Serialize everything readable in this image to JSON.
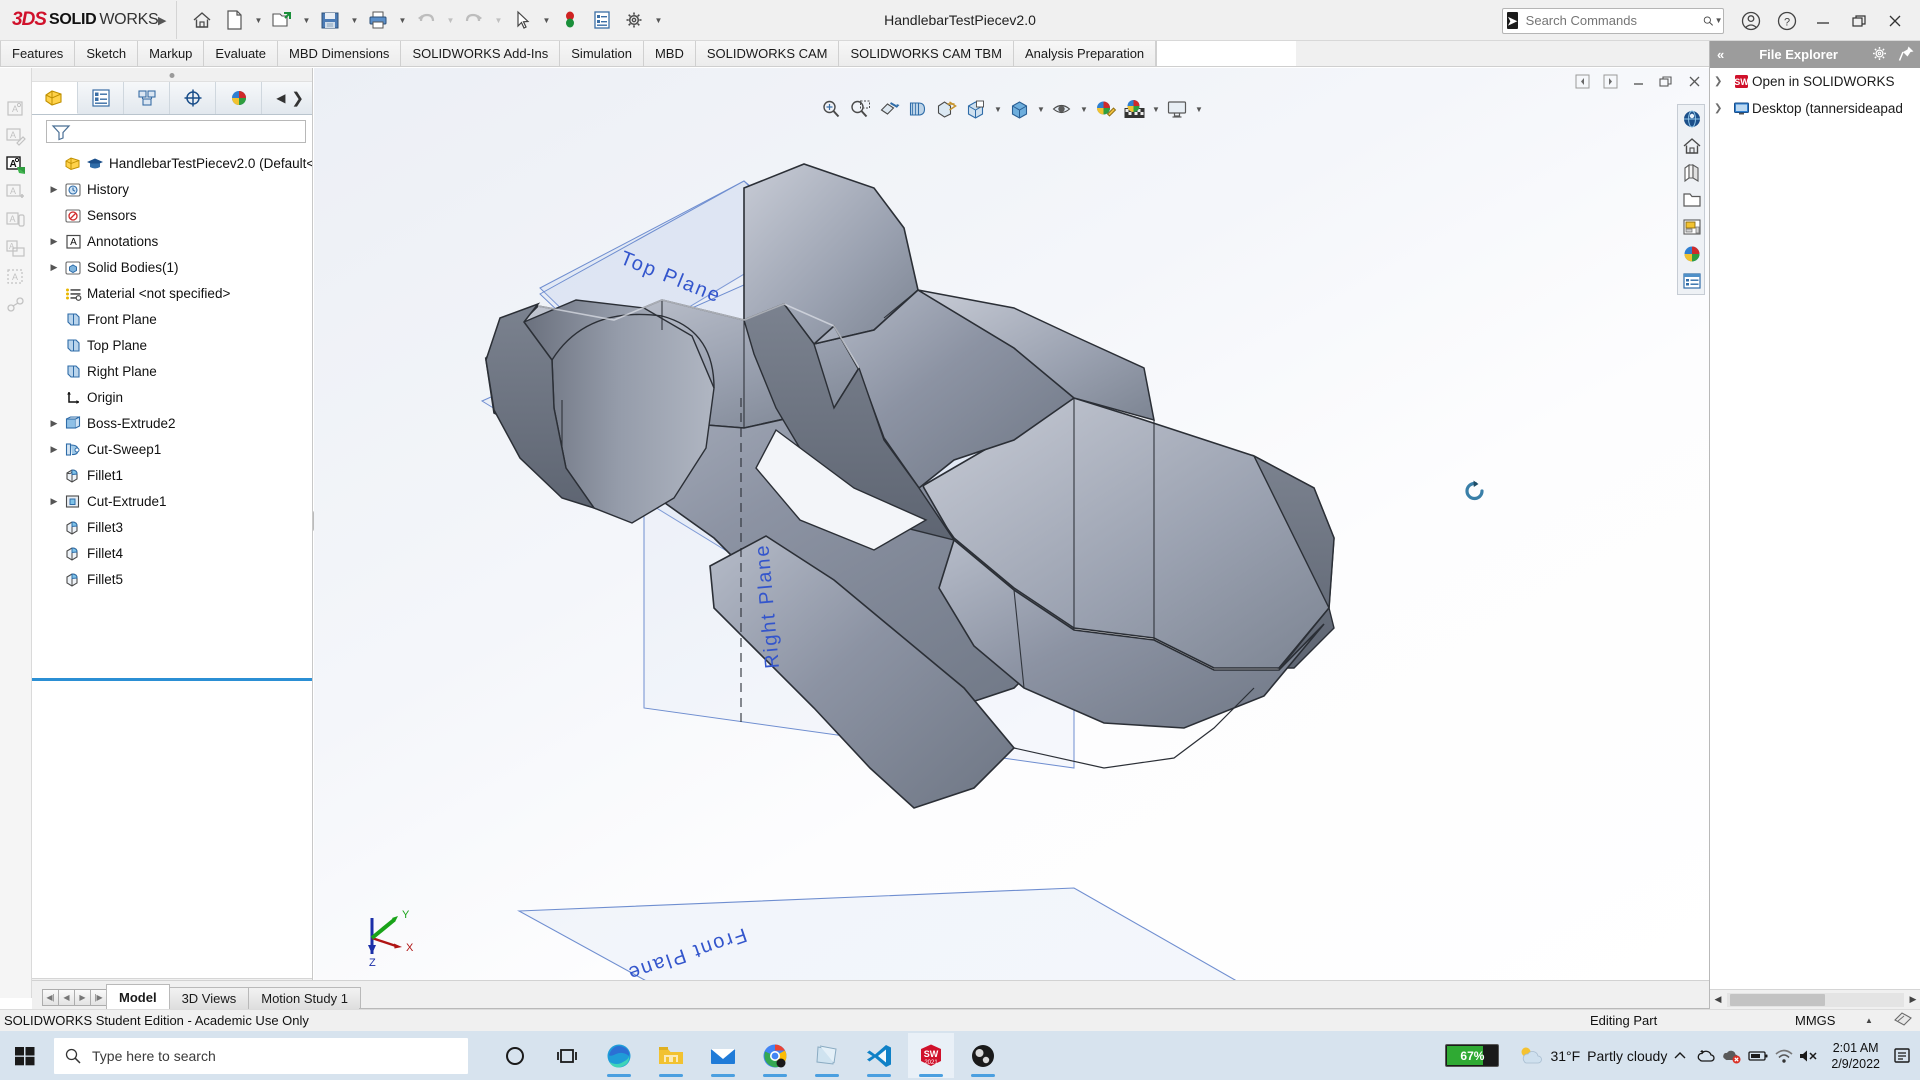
{
  "titlebar": {
    "brand_ds": "3DS",
    "brand_solid": "SOLID",
    "brand_works": "WORKS",
    "document_title": "HandlebarTestPiecev2.0",
    "quick_access": [
      {
        "name": "home-icon",
        "label": "Home"
      },
      {
        "name": "new-document-icon",
        "label": "New"
      },
      {
        "name": "open-document-icon",
        "label": "Open"
      },
      {
        "name": "save-icon",
        "label": "Save"
      },
      {
        "name": "print-icon",
        "label": "Print"
      },
      {
        "name": "undo-icon",
        "label": "Undo"
      },
      {
        "name": "redo-icon",
        "label": "Redo"
      },
      {
        "name": "select-cursor-icon",
        "label": "Select"
      },
      {
        "name": "rebuild-icon",
        "label": "Rebuild"
      },
      {
        "name": "file-properties-icon",
        "label": "File Properties"
      },
      {
        "name": "options-gear-icon",
        "label": "Options"
      }
    ],
    "search_placeholder": "Search Commands",
    "account_label": "Account",
    "help_label": "Help",
    "minimize_label": "Minimize",
    "restore_label": "Restore Down",
    "close_label": "Close"
  },
  "ribbon": {
    "tabs": [
      "Features",
      "Sketch",
      "Markup",
      "Evaluate",
      "MBD Dimensions",
      "SOLIDWORKS Add-Ins",
      "Simulation",
      "MBD",
      "SOLIDWORKS CAM",
      "SOLIDWORKS CAM TBM",
      "Analysis Preparation"
    ],
    "active_tab": "Features"
  },
  "left_strip": {
    "icons": [
      "annotation-note-icon",
      "annotation-edit-icon",
      "annotation-insert-icon",
      "annotation-add-icon",
      "annotation-balloon-icon",
      "annotation-print-icon",
      "annotation-pattern-icon",
      "annotation-link-icon"
    ]
  },
  "tree_panel": {
    "tabs": [
      {
        "name": "feature-manager-tab",
        "icon": "feature-tree-icon",
        "active": true
      },
      {
        "name": "property-manager-tab",
        "icon": "property-list-icon",
        "active": false
      },
      {
        "name": "configuration-manager-tab",
        "icon": "configuration-icon",
        "active": false
      },
      {
        "name": "dimxpert-manager-tab",
        "icon": "dimxpert-icon",
        "active": false
      },
      {
        "name": "display-manager-tab",
        "icon": "appearance-sphere-icon",
        "active": false
      }
    ],
    "filter_placeholder": "",
    "items": [
      {
        "label": "HandlebarTestPiecev2.0  (Default<",
        "icon": "part-document-icon",
        "indent": 0,
        "arrow": false,
        "extra_icon": "graduation-cap-icon"
      },
      {
        "label": "History",
        "icon": "history-folder-icon",
        "indent": 1,
        "arrow": true
      },
      {
        "label": "Sensors",
        "icon": "sensors-folder-icon",
        "indent": 1,
        "arrow": false
      },
      {
        "label": "Annotations",
        "icon": "annotations-icon",
        "indent": 1,
        "arrow": true
      },
      {
        "label": "Solid Bodies(1)",
        "icon": "solid-bodies-icon",
        "indent": 1,
        "arrow": true
      },
      {
        "label": "Material <not specified>",
        "icon": "material-icon",
        "indent": 1,
        "arrow": false
      },
      {
        "label": "Front Plane",
        "icon": "plane-icon",
        "indent": 1,
        "arrow": false
      },
      {
        "label": "Top Plane",
        "icon": "plane-icon",
        "indent": 1,
        "arrow": false
      },
      {
        "label": "Right Plane",
        "icon": "plane-icon",
        "indent": 1,
        "arrow": false
      },
      {
        "label": "Origin",
        "icon": "origin-icon",
        "indent": 1,
        "arrow": false
      },
      {
        "label": "Boss-Extrude2",
        "icon": "boss-extrude-icon",
        "indent": 1,
        "arrow": true
      },
      {
        "label": "Cut-Sweep1",
        "icon": "cut-sweep-icon",
        "indent": 1,
        "arrow": true
      },
      {
        "label": "Fillet1",
        "icon": "fillet-icon",
        "indent": 1,
        "arrow": false
      },
      {
        "label": "Cut-Extrude1",
        "icon": "cut-extrude-icon",
        "indent": 1,
        "arrow": true
      },
      {
        "label": "Fillet3",
        "icon": "fillet-icon",
        "indent": 1,
        "arrow": false
      },
      {
        "label": "Fillet4",
        "icon": "fillet-icon",
        "indent": 1,
        "arrow": false
      },
      {
        "label": "Fillet5",
        "icon": "fillet-icon",
        "indent": 1,
        "arrow": false
      }
    ]
  },
  "viewport": {
    "window_buttons": [
      "prev-document-icon",
      "next-document-icon",
      "minimize-icon",
      "restore-icon",
      "close-icon"
    ],
    "toolbar": [
      {
        "name": "zoom-to-fit-icon",
        "caret": false
      },
      {
        "name": "zoom-to-area-icon",
        "caret": false
      },
      {
        "name": "previous-view-icon",
        "caret": false
      },
      {
        "name": "section-view-icon",
        "caret": false
      },
      {
        "name": "view-orientation-icon",
        "caret": false
      },
      {
        "name": "display-style-icon",
        "caret": true
      },
      {
        "name": "hide-show-items-icon",
        "caret": true
      },
      {
        "name": "edit-appearance-icon",
        "caret": true
      },
      {
        "name": "apply-scene-icon",
        "caret": true
      },
      {
        "name": "view-settings-icon",
        "caret": true
      }
    ],
    "sidebar": [
      "view-orientation-globe-icon",
      "home-view-icon",
      "display-pane-icon",
      "open-folder-icon",
      "task-pane-icon",
      "appearances-icon",
      "custom-properties-icon"
    ],
    "plane_labels": [
      "Top Plane",
      "Right Plane",
      "Front Plane"
    ],
    "triad_axes": [
      "X",
      "Y",
      "Z"
    ],
    "cursor": "rotate-view-cursor"
  },
  "model_tabs": {
    "nav_buttons": [
      "first-tab-icon",
      "prev-tab-icon",
      "next-tab-icon",
      "last-tab-icon"
    ],
    "tabs": [
      "Model",
      "3D Views",
      "Motion Study 1"
    ],
    "active_tab": "Model"
  },
  "status_bar": {
    "left_text": "SOLIDWORKS Student Edition - Academic Use Only",
    "editing_state": "Editing Part",
    "units": "MMGS",
    "units_caret": "▲"
  },
  "file_explorer": {
    "title": "File Explorer",
    "collapse_label": "«",
    "settings_icon": "gear-icon",
    "pin_icon": "pin-icon",
    "rows": [
      {
        "label": "Open in SOLIDWORKS",
        "icon": "solidworks-doc-icon"
      },
      {
        "label": "Desktop (tannersideapad",
        "icon": "desktop-monitor-icon"
      }
    ]
  },
  "taskbar": {
    "start_label": "Start",
    "search_placeholder": "Type here to search",
    "pinned": [
      {
        "name": "cortana-icon",
        "open": false
      },
      {
        "name": "task-view-icon",
        "open": false
      },
      {
        "name": "microsoft-edge-icon",
        "open": true
      },
      {
        "name": "file-explorer-icon",
        "open": true
      },
      {
        "name": "mail-icon",
        "open": true
      },
      {
        "name": "google-chrome-icon",
        "open": true
      },
      {
        "name": "sticky-notes-icon",
        "open": true
      },
      {
        "name": "visual-studio-code-icon",
        "open": true
      },
      {
        "name": "solidworks-2021-icon",
        "open": true,
        "active": true
      },
      {
        "name": "obs-studio-icon",
        "open": true
      }
    ],
    "battery_percent": "67%",
    "weather_temp": "31°F",
    "weather_desc": "Partly cloudy",
    "tray_icons": [
      "show-hidden-icons-chevron",
      "onedrive-icon",
      "cloud-sync-error-icon",
      "battery-icon",
      "wifi-icon",
      "volume-muted-icon"
    ],
    "clock_time": "2:01 AM",
    "clock_date": "2/9/2022",
    "notification_icon": "action-center-icon"
  },
  "colors": {
    "brand_red": "#d0112b",
    "accent_blue": "#2b8fd4",
    "plane_blue": "#3355cc",
    "model_gray": "#8e95a6",
    "taskbar_bg": "#d7e3ee",
    "battery_green": "#2faa33"
  }
}
